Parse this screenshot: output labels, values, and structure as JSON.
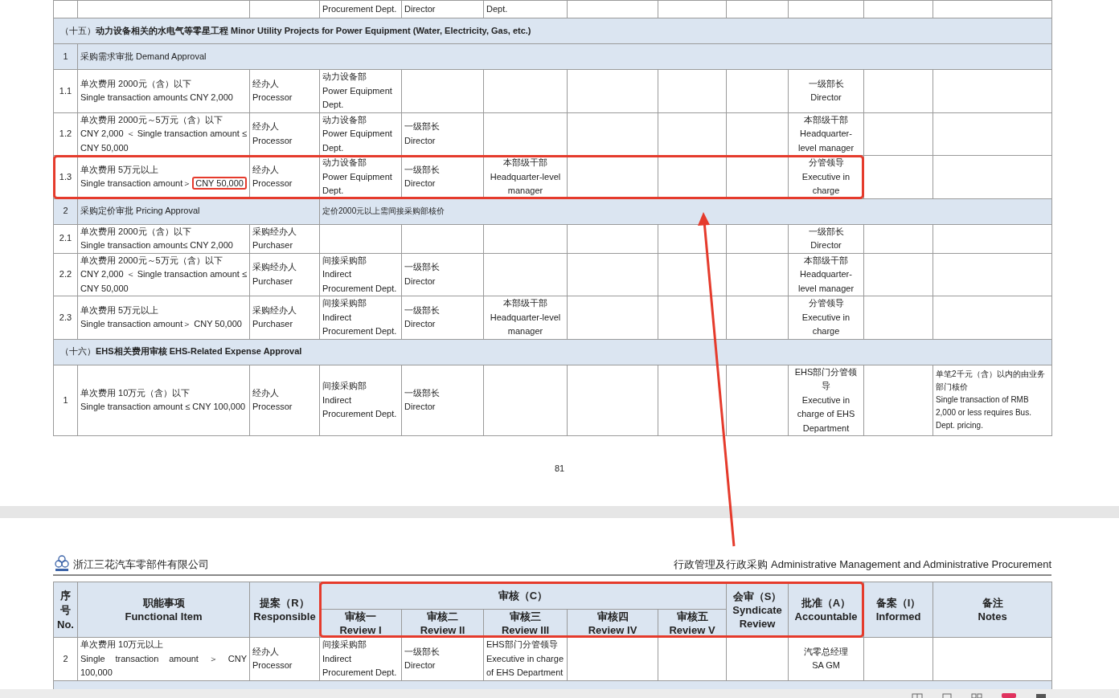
{
  "top_page": {
    "partial_row": {
      "review_1": "Procurement Dept.",
      "review_2": "Director",
      "review_3": "Dept."
    },
    "rows": [
      {
        "kind": "section",
        "title": "（十五）**动力设备相关的水电气等零星工程 Minor Utility Projects for Power Equipment (Water, Electricity, Gas, etc.)**"
      },
      {
        "kind": "group",
        "no": "1",
        "title": "采购需求审批  Demand Approval"
      },
      {
        "kind": "item",
        "cells": [
          "1.1",
          "单次费用 2000元（含）以下\nSingle transaction amount≤ CNY 2,000",
          "经办人\nProcessor",
          "动力设备部\nPower Equipment Dept.",
          "",
          "",
          "",
          "",
          "",
          "一级部长\nDirector",
          "",
          ""
        ]
      },
      {
        "kind": "item",
        "cells": [
          "1.2",
          "单次费用 2000元～5万元（含）以下\nCNY 2,000 ＜ Single transaction amount ≤ CNY 50,000",
          "经办人\nProcessor",
          "动力设备部\nPower Equipment Dept.",
          "一级部长\nDirector",
          "",
          "",
          "",
          "",
          "本部级干部\nHeadquarter-level manager",
          "",
          ""
        ]
      },
      {
        "kind": "item",
        "highlighted": true,
        "boxed": "CNY 50,000",
        "cells": [
          "1.3",
          "单次费用 5万元以上\nSingle transaction amount＞",
          "经办人\nProcessor",
          "动力设备部\nPower Equipment Dept.",
          "一级部长\nDirector",
          "本部级干部\nHeadquarter-level manager",
          "",
          "",
          "",
          "分管领导\nExecutive in charge",
          "",
          ""
        ]
      },
      {
        "kind": "group",
        "no": "2",
        "title": "采购定价审批  Pricing Approval",
        "note": "定价2000元以上需间接采购部核价"
      },
      {
        "kind": "item",
        "cells": [
          "2.1",
          "单次费用 2000元（含）以下\nSingle transaction amount≤ CNY 2,000",
          "采购经办人\nPurchaser",
          "",
          "",
          "",
          "",
          "",
          "",
          "一级部长\nDirector",
          "",
          ""
        ]
      },
      {
        "kind": "item",
        "cells": [
          "2.2",
          "单次费用 2000元～5万元（含）以下\nCNY 2,000 ＜ Single transaction amount ≤ CNY 50,000",
          "采购经办人\nPurchaser",
          "间接采购部\nIndirect Procurement Dept.",
          "一级部长\nDirector",
          "",
          "",
          "",
          "",
          "本部级干部\nHeadquarter-level manager",
          "",
          ""
        ]
      },
      {
        "kind": "item",
        "cells": [
          "2.3",
          "单次费用 5万元以上\nSingle transaction amount＞ CNY 50,000",
          "采购经办人\nPurchaser",
          "间接采购部\nIndirect Procurement Dept.",
          "一级部长\nDirector",
          "本部级干部\nHeadquarter-level manager",
          "",
          "",
          "",
          "分管领导\nExecutive in charge",
          "",
          ""
        ]
      },
      {
        "kind": "section",
        "title": "（十六）**EHS相关费用审核 EHS-Related Expense Approval**"
      },
      {
        "kind": "item",
        "cells": [
          "1",
          "单次费用 10万元（含）以下\nSingle transaction amount ≤ CNY 100,000",
          "经办人\nProcessor",
          "间接采购部\nIndirect Procurement Dept.",
          "一级部长\nDirector",
          "",
          "",
          "",
          "",
          "EHS部门分管领导\nExecutive in charge of EHS Department",
          "",
          "单笔2千元（含）以内的由业务部门核价\nSingle transaction of RMB 2,000 or less requires Bus. Dept. pricing."
        ]
      }
    ],
    "page_number": "81"
  },
  "bottom_page": {
    "company": "浙江三花汽车零部件有限公司",
    "chapter": "行政管理及行政采购 Administrative Management and Administrative Procurement",
    "header": {
      "highlighted": true,
      "no_cn": "序号",
      "no_en": "No.",
      "item": "职能事项\nFunctional Item",
      "responsible": "提案（R）\nResponsible",
      "review_group": "审核（C）",
      "reviews": [
        "审核一\nReview I",
        "审核二\nReview II",
        "审核三\nReview III",
        "审核四\nReview IV",
        "审核五\nReview V"
      ],
      "syndicate": "会审（S）\nSyndicate Review",
      "accountable": "批准（A）\nAccountable",
      "informed": "备案（I）\nInformed",
      "notes": "备注\nNotes"
    },
    "rows": [
      {
        "kind": "item",
        "cells": [
          "2",
          "单次费用 10万元以上\nSingle transaction amount ＞ CNY 100,000",
          "经办人\nProcessor",
          "间接采购部\nIndirect Procurement Dept.",
          "一级部长\nDirector",
          "EHS部门分管领导\nExecutive in charge of EHS Department",
          "",
          "",
          "",
          "汽零总经理\nSA GM",
          "",
          ""
        ]
      },
      {
        "kind": "section",
        "title": ""
      }
    ]
  }
}
